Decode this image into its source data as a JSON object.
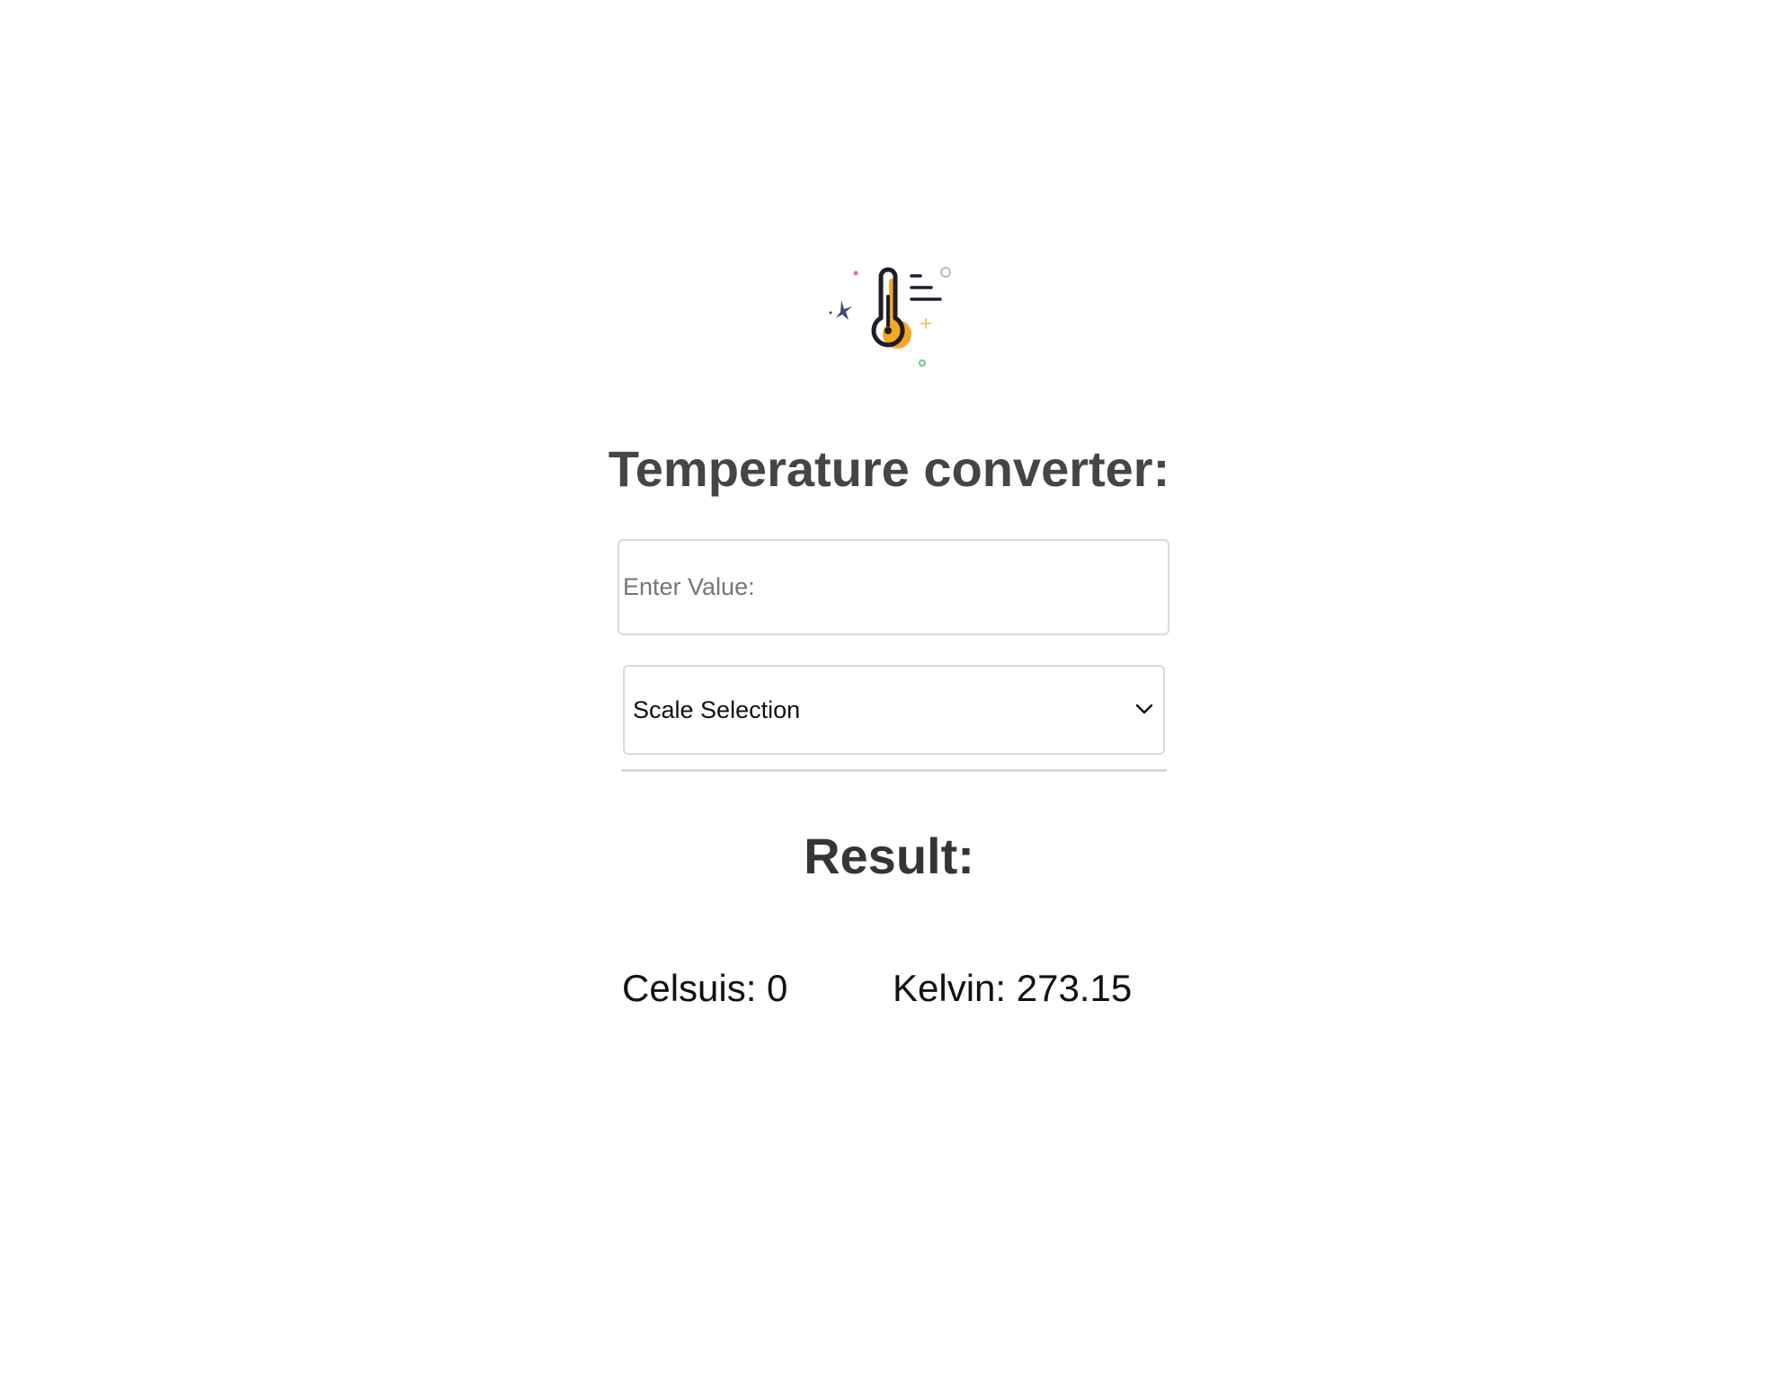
{
  "header": {
    "logo_icon": "thermometer-icon",
    "title": "Temperature converter:"
  },
  "form": {
    "value_placeholder": "Enter Value:",
    "value": "",
    "scale_select": {
      "selected": "Scale Selection",
      "icon": "chevron-down-icon"
    }
  },
  "result": {
    "title": "Result:",
    "celsius_label": "Celsuis: 0",
    "kelvin_label": "Kelvin: 273.15"
  },
  "colors": {
    "accent": "#F4A825",
    "ink": "#1F1D2B"
  }
}
